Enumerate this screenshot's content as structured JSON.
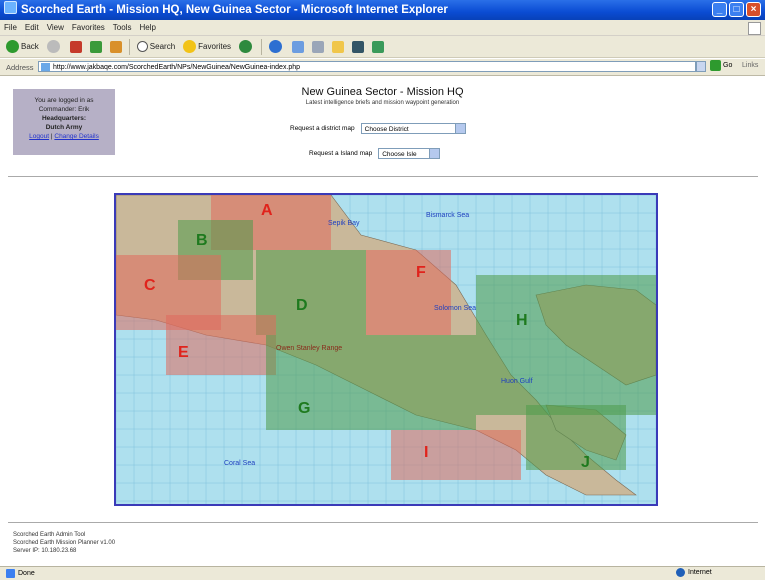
{
  "window": {
    "title": "Scorched Earth - Mission HQ, New Guinea Sector - Microsoft Internet Explorer",
    "btn_min": "_",
    "btn_max": "□",
    "btn_close": "×"
  },
  "menu": [
    "File",
    "Edit",
    "View",
    "Favorites",
    "Tools",
    "Help"
  ],
  "toolbar": {
    "back": "Back",
    "search": "Search",
    "favorites": "Favorites"
  },
  "address": {
    "label": "Address",
    "url": "http://www.jakbaqe.com/ScorchedEarth/NPs/NewGuinea/NewGuinea-index.php",
    "go": "Go",
    "links": "Links"
  },
  "login": {
    "line1": "You are logged in as",
    "line2": "Commander: Erik",
    "line3": "Headquarters:",
    "line4": "Dutch Army",
    "logout": "Logout",
    "change": "Change Details"
  },
  "header": {
    "title": "New Guinea Sector - Mission HQ",
    "subtitle": "Latest intelligence briefs and mission waypoint generation",
    "district_label": "Request a district map",
    "district_value": "Choose District",
    "island_label": "Request a Island map",
    "island_value": "Choose Isle"
  },
  "map": {
    "sectors": [
      "A",
      "B",
      "C",
      "D",
      "E",
      "F",
      "G",
      "H",
      "I",
      "J"
    ],
    "sea_labels": [
      "Bismarck Sea",
      "Solomon Sea",
      "Coral Sea",
      "Sepik Bay",
      "Owen Stanley Range",
      "Huon Gulf"
    ],
    "colors": {
      "sea": "#aee0ee",
      "grid": "#6fb6d6",
      "land": "#c9b89a",
      "red_zone": "#e06a5c",
      "green_zone": "#4f9a4a",
      "border": "#3a3ab8"
    }
  },
  "footer": {
    "line1": "Scorched Earth Admin Tool",
    "line2": "Scorched Earth Mission Planner v1.00",
    "line3": "Server IP: 10.180.23.68"
  },
  "status": {
    "left": "Done",
    "right": "Internet"
  }
}
